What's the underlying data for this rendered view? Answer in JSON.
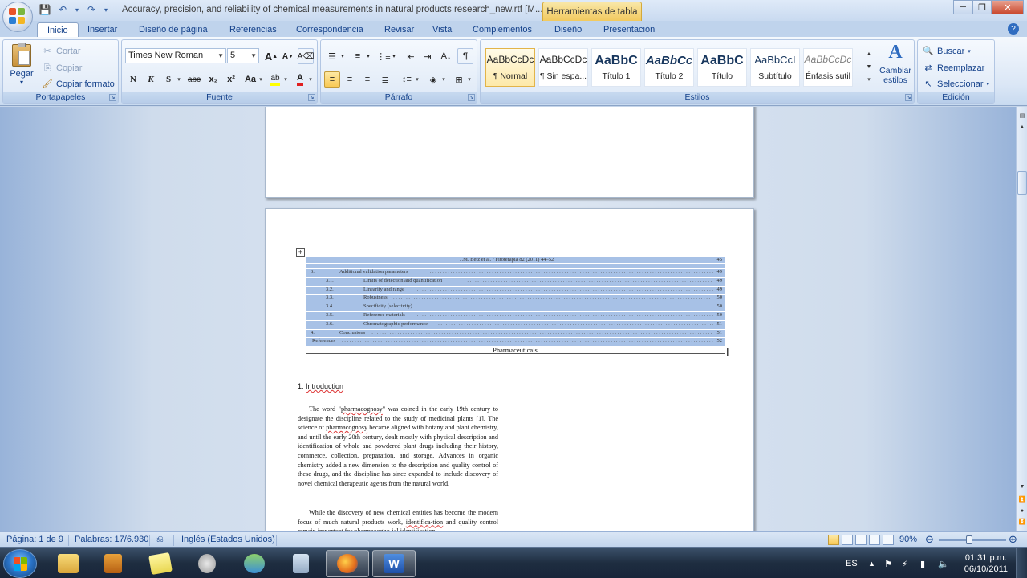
{
  "titlebar": {
    "doc_title": "Accuracy, precision, and reliability of chemical measurements in natural products research_new.rtf [M...",
    "tool_tab": "Herramientas de tabla",
    "minimize": "─",
    "restore": "❐",
    "close": "✕"
  },
  "tabs": [
    "Inicio",
    "Insertar",
    "Diseño de página",
    "Referencias",
    "Correspondencia",
    "Revisar",
    "Vista",
    "Complementos",
    "Diseño",
    "Presentación"
  ],
  "ribbon": {
    "clipboard": {
      "paste": "Pegar",
      "cut": "Cortar",
      "copy": "Copiar",
      "format_painter": "Copiar formato",
      "label": "Portapapeles"
    },
    "font": {
      "family": "Times New Roman",
      "size": "5",
      "label": "Fuente",
      "bold": "N",
      "italic": "K",
      "underline": "S",
      "strike": "abc",
      "subscript": "x₂",
      "superscript": "x²",
      "case": "Aa",
      "grow": "A",
      "shrink": "A"
    },
    "paragraph": {
      "label": "Párrafo"
    },
    "styles": {
      "label": "Estilos",
      "items": [
        {
          "sample": "AaBbCcDc",
          "name": "¶ Normal"
        },
        {
          "sample": "AaBbCcDc",
          "name": "¶ Sin espa..."
        },
        {
          "sample": "AaBbC",
          "name": "Título 1"
        },
        {
          "sample": "AaBbCc",
          "name": "Título 2"
        },
        {
          "sample": "AaBbC",
          "name": "Título"
        },
        {
          "sample": "AaBbCcI",
          "name": "Subtítulo"
        },
        {
          "sample": "AaBbCcDc",
          "name": "Énfasis sutil"
        }
      ],
      "change_styles": "Cambiar estilos"
    },
    "editing": {
      "label": "Edición",
      "find": "Buscar",
      "replace": "Reemplazar",
      "select": "Seleccionar"
    }
  },
  "document": {
    "toc_header": "J.M. Betz et al. / Fitoterapia 82 (2011) 44–52",
    "toc_header_page": "45",
    "toc_rows": [
      {
        "num": "3.",
        "title": "Additional validation parameters",
        "page": "49",
        "indent": 0
      },
      {
        "num": "3.1.",
        "title": "Limits of detection and quantification",
        "page": "49",
        "indent": 1
      },
      {
        "num": "3.2.",
        "title": "Linearity and range",
        "page": "49",
        "indent": 1
      },
      {
        "num": "3.3.",
        "title": "Robustness",
        "page": "50",
        "indent": 1
      },
      {
        "num": "3.4.",
        "title": "Specificity (selectivity)",
        "page": "50",
        "indent": 1
      },
      {
        "num": "3.5.",
        "title": "Reference materials",
        "page": "50",
        "indent": 1
      },
      {
        "num": "3.6.",
        "title": "Chromatographic performance",
        "page": "51",
        "indent": 1
      },
      {
        "num": "4.",
        "title": "Conclusions",
        "page": "51",
        "indent": 0
      },
      {
        "num": "",
        "title": "References",
        "page": "52",
        "indent": -1
      }
    ],
    "toc_footer": "Pharmaceuticals",
    "section_num": "1.",
    "section_title": "Introduction",
    "para1_a": "The word \"",
    "para1_word": "pharmacognosy",
    "para1_b": "\" was coined in the early 19th century to designate the discipline related to the study of medicinal plants [1]. The science of ",
    "para1_word2": "pharmacognosy",
    "para1_c": " became aligned with botany and plant chemistry, and until the early 20th century, dealt mostly with physical description and identification of whole and powdered plant drugs including their history, commerce, collection, preparation, and storage. Advances in organic chemistry added a new dimension to the description and quality control of these drugs, and the discipline has since expanded to include discovery of novel chemical therapeutic agents from the natural world.",
    "para2_a": "While the discovery of new chemical entities has become the modern focus of much natural products work, ",
    "para2_word": "identifica-tion",
    "para2_b": " and quality control remain important for pharmacogno-ial identification"
  },
  "statusbar": {
    "page": "Página: 1 de 9",
    "words": "Palabras: 17/6.930",
    "language": "Inglés (Estados Unidos)",
    "zoom": "90%",
    "zoom_level": 0.9
  },
  "taskbar": {
    "lang": "ES",
    "time": "01:31 p.m.",
    "date": "06/10/2011"
  }
}
